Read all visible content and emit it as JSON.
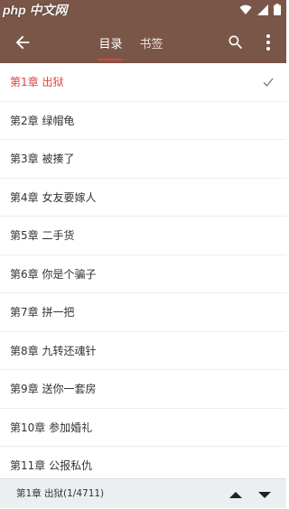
{
  "status_bar": {
    "watermark": "php 中文网",
    "icons": [
      "wifi-icon",
      "signal-icon",
      "battery-icon"
    ]
  },
  "toolbar": {
    "tabs": [
      {
        "label": "目录",
        "active": true
      },
      {
        "label": "书签",
        "active": false
      }
    ],
    "icons": [
      "back-arrow-icon",
      "search-icon",
      "more-vert-icon"
    ]
  },
  "chapters": [
    {
      "label": "第1章  出狱",
      "current": true
    },
    {
      "label": "第2章  绿帽龟",
      "current": false
    },
    {
      "label": "第3章  被揍了",
      "current": false
    },
    {
      "label": "第4章  女友要嫁人",
      "current": false
    },
    {
      "label": "第5章  二手货",
      "current": false
    },
    {
      "label": "第6章  你是个骗子",
      "current": false
    },
    {
      "label": "第7章  拼一把",
      "current": false
    },
    {
      "label": "第8章  九转还魂针",
      "current": false
    },
    {
      "label": "第9章   送你一套房",
      "current": false
    },
    {
      "label": "第10章  参加婚礼",
      "current": false
    },
    {
      "label": "第11章  公报私仇",
      "current": false
    }
  ],
  "bottom_bar": {
    "progress_text": "第1章  出狱(1/4711)",
    "icons": [
      "arrow-up-icon",
      "arrow-down-icon"
    ]
  },
  "colors": {
    "toolbar": "#7a5648",
    "accent": "#e0413d",
    "bottom_bar": "#eceff1"
  }
}
